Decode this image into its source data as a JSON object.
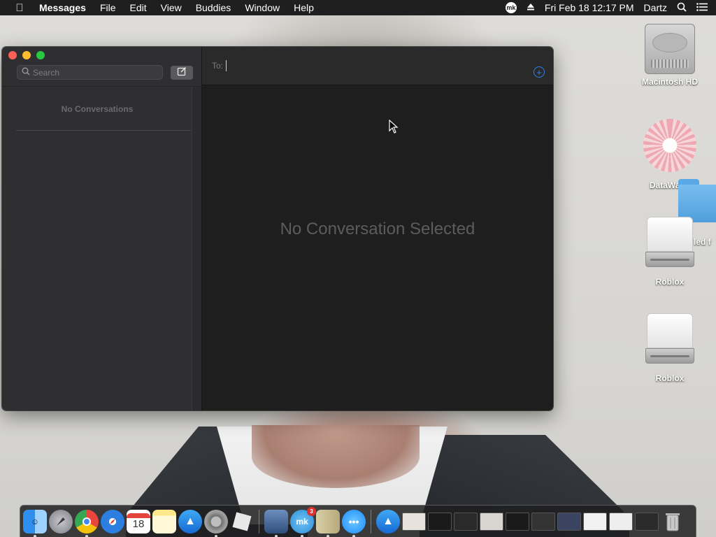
{
  "menubar": {
    "app_name": "Messages",
    "menus": [
      "File",
      "Edit",
      "View",
      "Buddies",
      "Window",
      "Help"
    ],
    "status": {
      "mk_label": "mk",
      "datetime": "Fri Feb 18  12:17 PM",
      "user": "Dartz"
    }
  },
  "messages": {
    "search_placeholder": "Search",
    "no_conversations": "No Conversations",
    "to_label": "To:",
    "to_placeholder": "",
    "empty_state": "No Conversation Selected",
    "accent_color": "#2f80ed"
  },
  "desktop": {
    "icons": [
      {
        "label": "Macintosh HD"
      },
      {
        "label": "DataWago"
      },
      {
        "label": "Roblox"
      },
      {
        "label": "Roblox"
      }
    ],
    "partial_folder_label": "led f"
  },
  "dock": {
    "calendar_day": "18",
    "mk_label": "mk",
    "mk_badge": "3"
  }
}
